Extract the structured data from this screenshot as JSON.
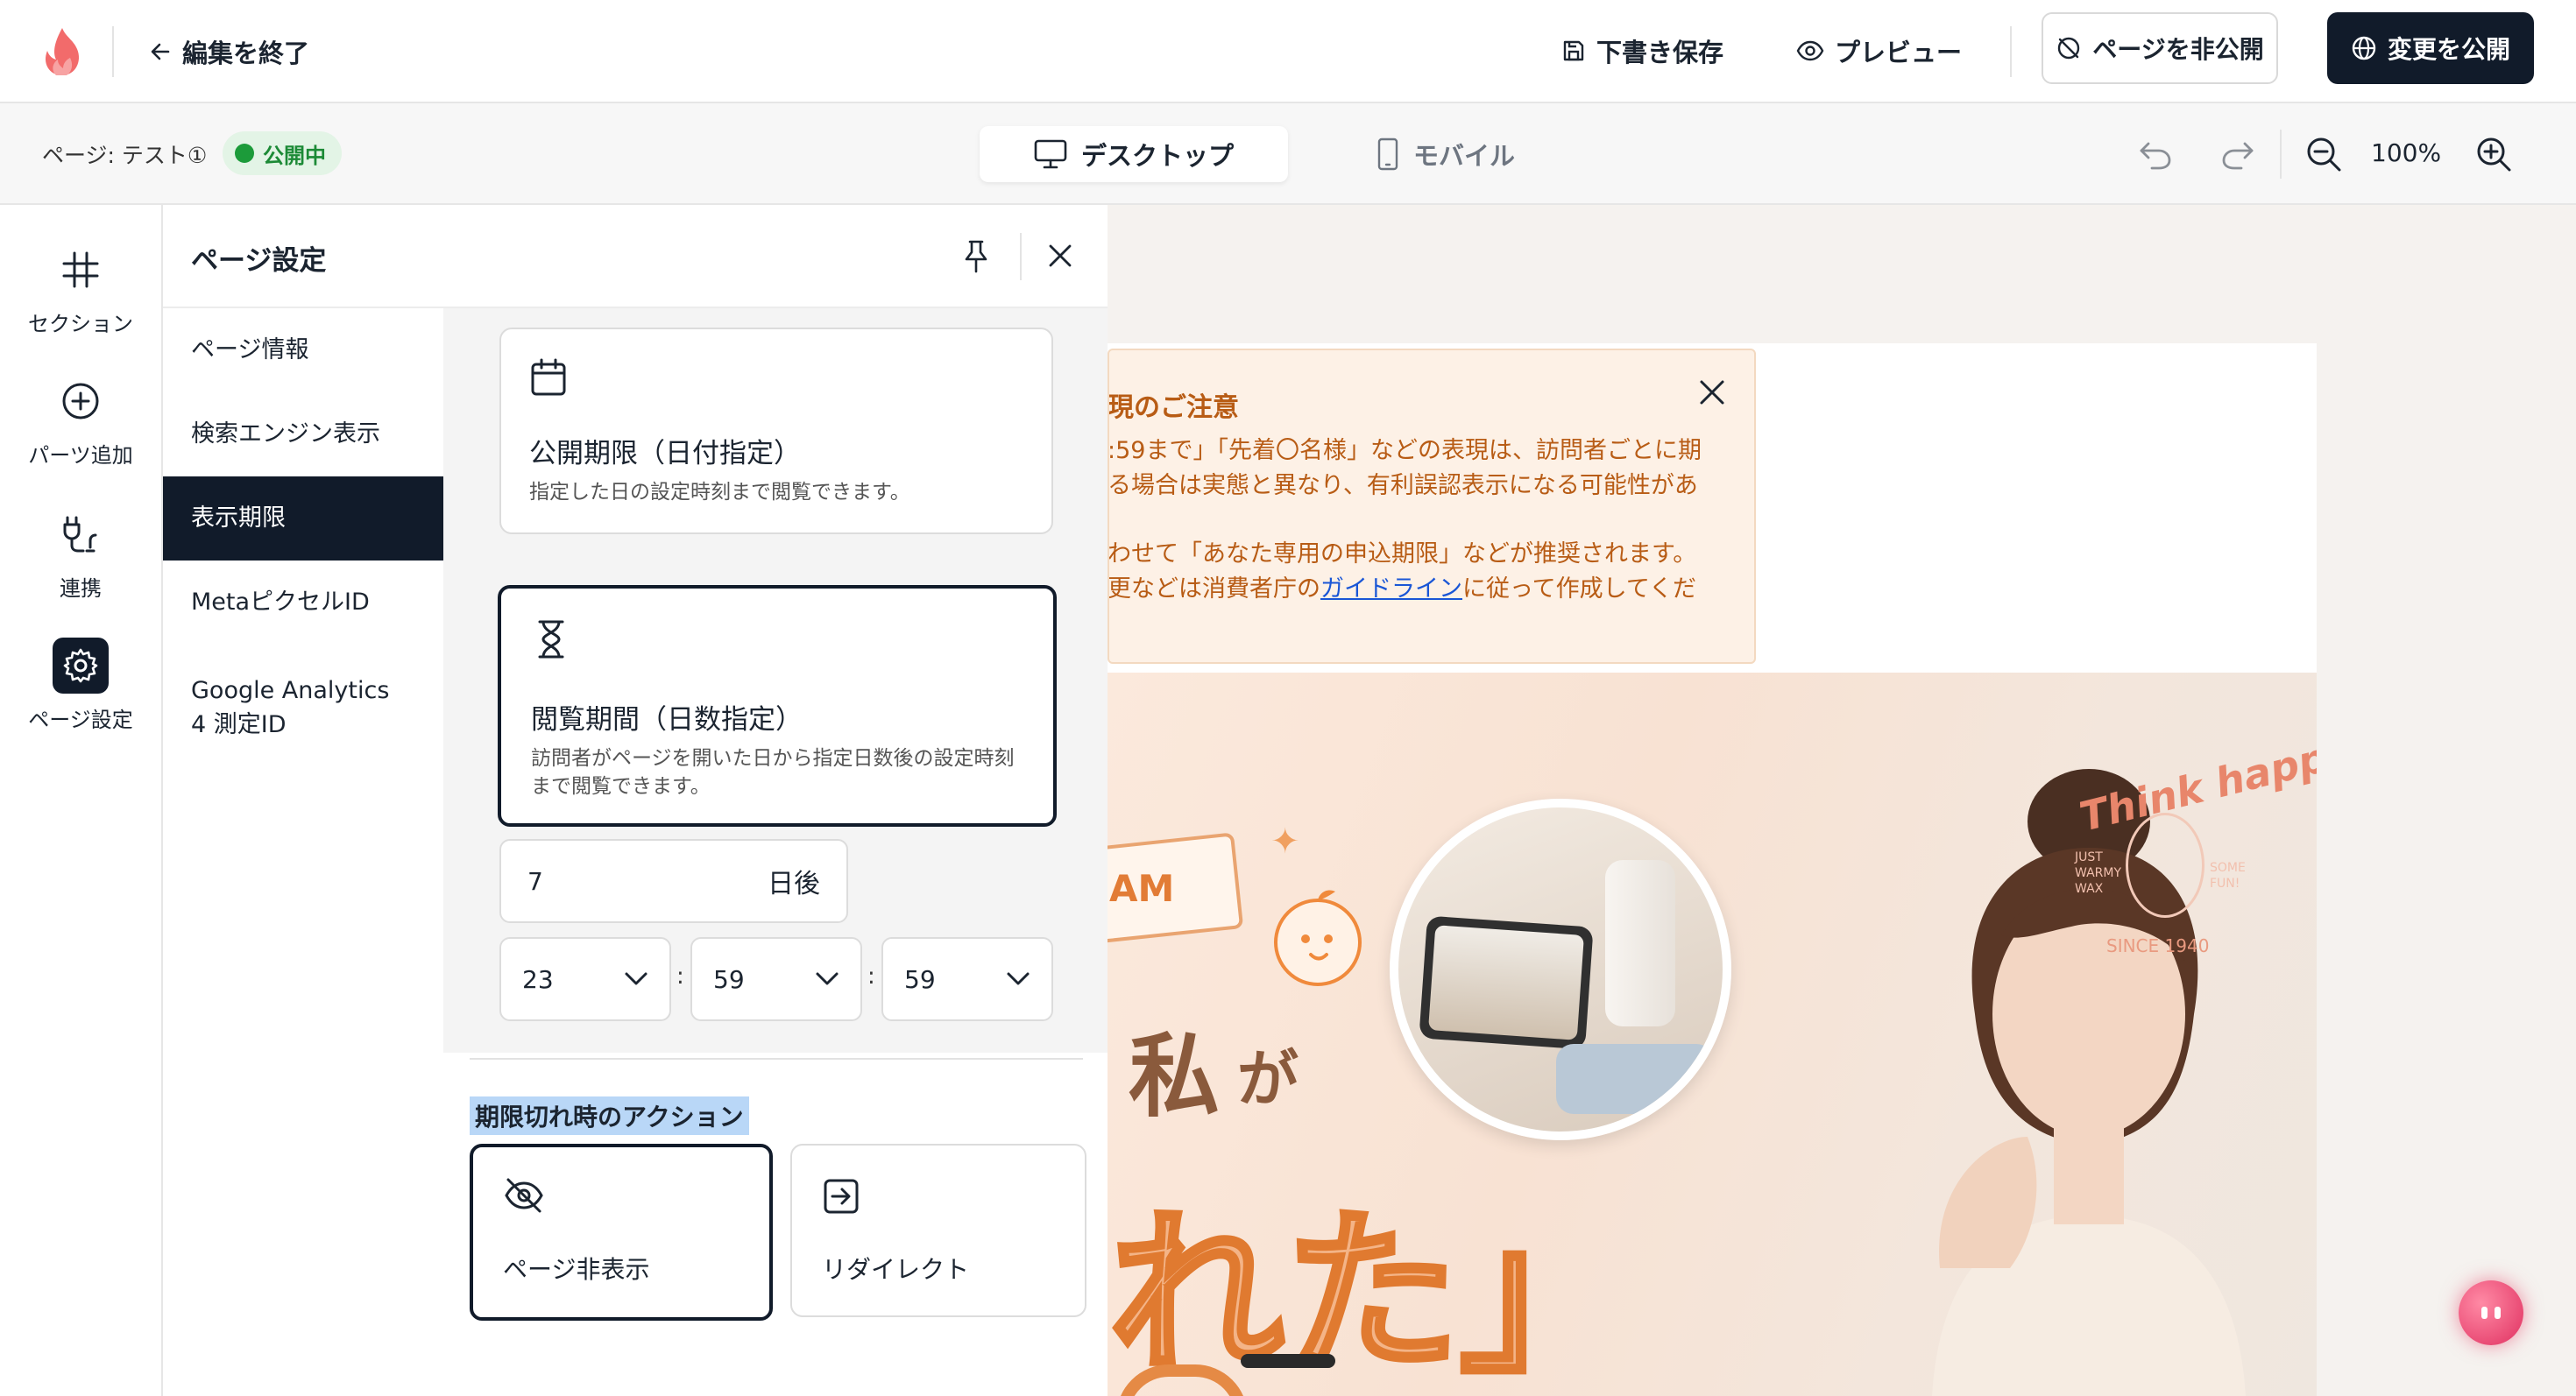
{
  "header": {
    "back_label": "編集を終了",
    "save_draft_label": "下書き保存",
    "preview_label": "プレビュー",
    "unpublish_label": "ページを非公開",
    "publish_label": "変更を公開"
  },
  "subbar": {
    "page_label": "ページ: テスト①",
    "status": "公開中",
    "view_desktop": "デスクトップ",
    "view_mobile": "モバイル",
    "zoom": "100%"
  },
  "rail": {
    "items": [
      {
        "label": "セクション",
        "icon": "hash-icon"
      },
      {
        "label": "パーツ追加",
        "icon": "plus-circle-icon"
      },
      {
        "label": "連携",
        "icon": "plug-icon"
      },
      {
        "label": "ページ設定",
        "icon": "gear-icon"
      }
    ]
  },
  "panel": {
    "title": "ページ設定",
    "submenu": [
      {
        "label": "ページ情報"
      },
      {
        "label": "検索エンジン表示"
      },
      {
        "label": "表示期限"
      },
      {
        "label": "MetaピクセルID"
      },
      {
        "label": "Google Analytics 4 測定ID"
      }
    ],
    "date_option": {
      "title": "公開期限（日付指定）",
      "desc": "指定した日の設定時刻まで閲覧できます。"
    },
    "days_option": {
      "title": "閲覧期間（日数指定）",
      "desc": "訪問者がページを開いた日から指定日数後の設定時刻まで閲覧できます。"
    },
    "days_value": "7",
    "days_suffix": "日後",
    "time": {
      "hour": "23",
      "minute": "59",
      "second": "59"
    },
    "time_sep": ":",
    "expiry_section_label": "期限切れ時のアクション",
    "expiry_actions": [
      {
        "label": "ページ非表示",
        "icon": "eye-off-icon"
      },
      {
        "label": "リダイレクト",
        "icon": "redirect-icon"
      }
    ]
  },
  "preview": {
    "notice": {
      "title": "現のご注意",
      "line1": ":59まで」「先着〇名様」などの表現は、訪問者ごとに期",
      "line2": "る場合は実態と異なり、有利誤認表示になる可能性があ",
      "line3": "わせて「あなた専用の申込期限」などが推奨されます。",
      "line4_pre": "更などは消費者庁の",
      "line4_link": "ガイドライン",
      "line4_post": "に従って作成してくだ"
    },
    "hero": {
      "badge_text": "AM",
      "text_line1": "私",
      "text_line1b": "が",
      "text_line2": "れた」",
      "logo_text": "Think happy",
      "logo_left": "JUST WARMY WAX",
      "logo_right": "SOME FUN!",
      "logo_since": "SINCE 1940"
    }
  },
  "colors": {
    "primary_dark": "#111b2a",
    "status_green": "#1c9b3a",
    "notice_text": "#b85c15",
    "link": "#1a56d6",
    "brand": "#ef5350"
  }
}
